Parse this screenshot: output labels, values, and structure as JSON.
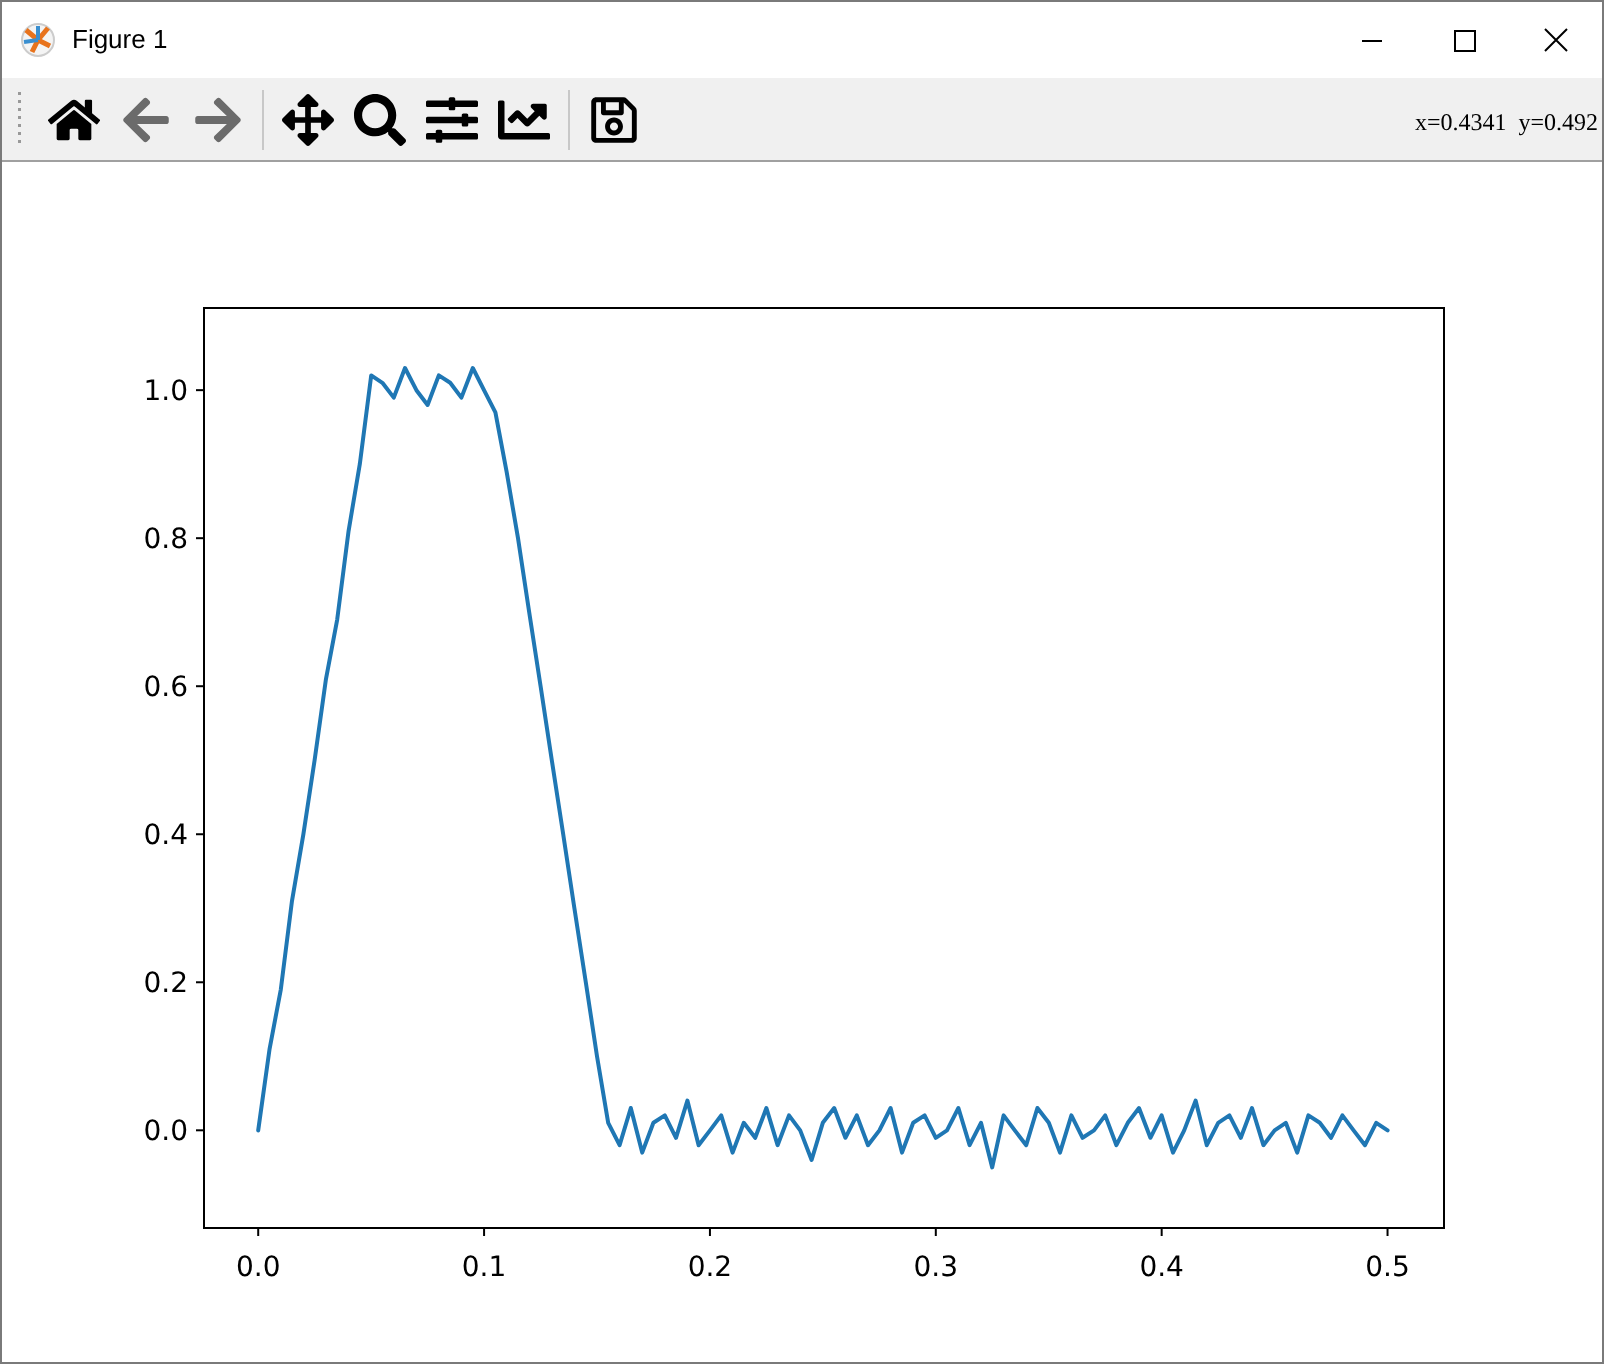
{
  "window": {
    "title": "Figure 1"
  },
  "toolbar": {
    "groups": [
      [
        {
          "kind": "home",
          "disabled": false
        },
        {
          "kind": "back",
          "disabled": true
        },
        {
          "kind": "forward",
          "disabled": true
        }
      ],
      [
        {
          "kind": "pan",
          "disabled": false
        },
        {
          "kind": "zoom",
          "disabled": false
        },
        {
          "kind": "subplots",
          "disabled": false
        },
        {
          "kind": "axes",
          "disabled": false
        }
      ],
      [
        {
          "kind": "save",
          "disabled": false
        }
      ]
    ],
    "coordinates": "x=0.4341  y=0.492"
  },
  "plot": {
    "chart_data": {
      "type": "line",
      "xlim": [
        -0.024,
        0.525
      ],
      "ylim": [
        -0.132,
        1.111
      ],
      "xticks": [
        {
          "value": 0,
          "label": "0.0"
        },
        {
          "value": 0.1,
          "label": "0.1"
        },
        {
          "value": 0.2,
          "label": "0.2"
        },
        {
          "value": 0.3,
          "label": "0.3"
        },
        {
          "value": 0.4,
          "label": "0.4"
        },
        {
          "value": 0.5,
          "label": "0.5"
        }
      ],
      "yticks": [
        {
          "value": 0,
          "label": "0.0"
        },
        {
          "value": 0.2,
          "label": "0.2"
        },
        {
          "value": 0.4,
          "label": "0.4"
        },
        {
          "value": 0.6,
          "label": "0.6"
        },
        {
          "value": 0.8,
          "label": "0.8"
        },
        {
          "value": 1,
          "label": "1.0"
        }
      ],
      "x": [
        0,
        0.005,
        0.01,
        0.015,
        0.02,
        0.025,
        0.03,
        0.035,
        0.04,
        0.045,
        0.05,
        0.055,
        0.06,
        0.065,
        0.07,
        0.075,
        0.08,
        0.085,
        0.09,
        0.095,
        0.1,
        0.105,
        0.11,
        0.115,
        0.12,
        0.125,
        0.13,
        0.135,
        0.14,
        0.145,
        0.15,
        0.155,
        0.16,
        0.165,
        0.17,
        0.175,
        0.18,
        0.185,
        0.19,
        0.195,
        0.2,
        0.205,
        0.21,
        0.215,
        0.22,
        0.225,
        0.23,
        0.235,
        0.24,
        0.245,
        0.25,
        0.255,
        0.26,
        0.265,
        0.27,
        0.275,
        0.28,
        0.285,
        0.29,
        0.295,
        0.3,
        0.305,
        0.31,
        0.315,
        0.32,
        0.325,
        0.33,
        0.335,
        0.34,
        0.345,
        0.35,
        0.355,
        0.36,
        0.365,
        0.37,
        0.375,
        0.38,
        0.385,
        0.39,
        0.395,
        0.4,
        0.405,
        0.41,
        0.415,
        0.42,
        0.425,
        0.43,
        0.435,
        0.44,
        0.445,
        0.45,
        0.455,
        0.46,
        0.465,
        0.47,
        0.475,
        0.48,
        0.485,
        0.49,
        0.495,
        0.5
      ],
      "series": [
        {
          "color": "#1f77b4",
          "values": [
            0.0,
            0.11,
            0.19,
            0.31,
            0.4,
            0.5,
            0.61,
            0.69,
            0.81,
            0.9,
            1.02,
            1.01,
            0.99,
            1.03,
            1.0,
            0.98,
            1.02,
            1.01,
            0.99,
            1.03,
            1.0,
            0.97,
            0.89,
            0.8,
            0.7,
            0.6,
            0.5,
            0.4,
            0.3,
            0.2,
            0.1,
            0.01,
            -0.02,
            0.03,
            -0.03,
            0.01,
            0.02,
            -0.01,
            0.04,
            -0.02,
            0.0,
            0.02,
            -0.03,
            0.01,
            -0.01,
            0.03,
            -0.02,
            0.02,
            0.0,
            -0.04,
            0.01,
            0.03,
            -0.01,
            0.02,
            -0.02,
            0.0,
            0.03,
            -0.03,
            0.01,
            0.02,
            -0.01,
            0.0,
            0.03,
            -0.02,
            0.01,
            -0.05,
            0.02,
            0.0,
            -0.02,
            0.03,
            0.01,
            -0.03,
            0.02,
            -0.01,
            0.0,
            0.02,
            -0.02,
            0.01,
            0.03,
            -0.01,
            0.02,
            -0.03,
            0.0,
            0.04,
            -0.02,
            0.01,
            0.02,
            -0.01,
            0.03,
            -0.02,
            0.0,
            0.01,
            -0.03,
            0.02,
            0.01,
            -0.01,
            0.02,
            0.0,
            -0.02,
            0.01,
            0.0
          ]
        }
      ]
    }
  }
}
